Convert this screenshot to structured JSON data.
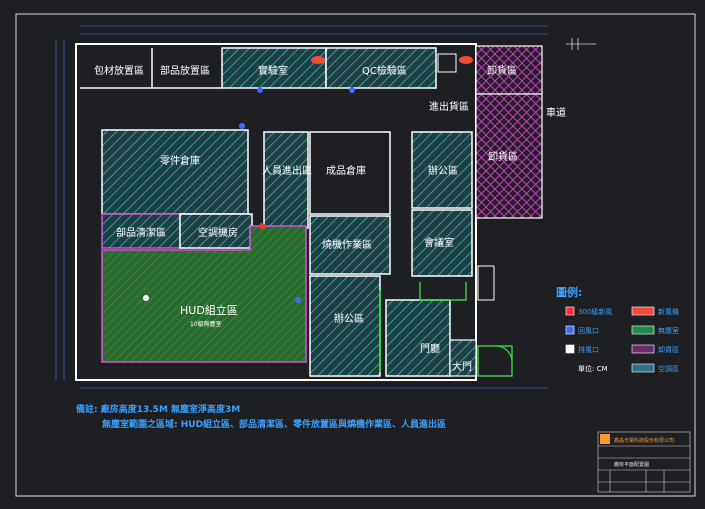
{
  "rooms": {
    "packaging": "包材放置區",
    "parts_storage": "部品放置區",
    "lab": "實驗室",
    "qc": "QC檢驗區",
    "unloading_top": "卸貨區",
    "in_out_zone": "進出貨區",
    "road": "車道",
    "parts_warehouse": "零件倉庫",
    "personnel_exit": "人員進出區",
    "finished_goods": "成品倉庫",
    "office_right": "辦公區",
    "unloading_right": "卸貨區",
    "parts_cleaning": "部品清潔區",
    "ac_room": "空調機房",
    "burn_in": "燒機作業區",
    "meeting_room": "會議室",
    "hud_assembly": "HUD組立區",
    "hud_sub": "10級無塵室",
    "office_lower": "辦公區",
    "lobby": "門廳",
    "gate": "大門"
  },
  "legend": {
    "title": "圖例:",
    "items": [
      {
        "label": "300級新風",
        "swatch": "#ff2d2d"
      },
      {
        "label": "新風機",
        "swatch": "#f04a3a"
      },
      {
        "label": "回風口",
        "swatch": "#3b6cff"
      },
      {
        "label": "無塵室",
        "swatch": "#1e8a4a"
      },
      {
        "label": "排風口",
        "swatch": "#ffffff"
      },
      {
        "label": "卸貨區",
        "swatch": "#6b2a6b"
      },
      {
        "label": "單位: CM",
        "swatch": ""
      },
      {
        "label": "空調區",
        "swatch": "#2e6f8a"
      }
    ]
  },
  "notes": {
    "line1": "備註: 廠房高度13.5M  無塵室淨高度3M",
    "line2": "無塵室範圍之區域: HUD組立區、部品清潔區、零件放置區與燒機作業區、人員進出區"
  },
  "title_block": {
    "company": "鑫晶光電科技股份有限公司",
    "drawing": "廠房平面配置圖"
  },
  "colors": {
    "background": "#1d1f23",
    "wall": "#ffffff",
    "hatch_cyan": "#2fb8b0",
    "hatch_green": "#2e7d32",
    "hatch_magenta": "#c04bc0",
    "note_text": "#3aa0ff",
    "legend_text": "#3aa0ff"
  }
}
